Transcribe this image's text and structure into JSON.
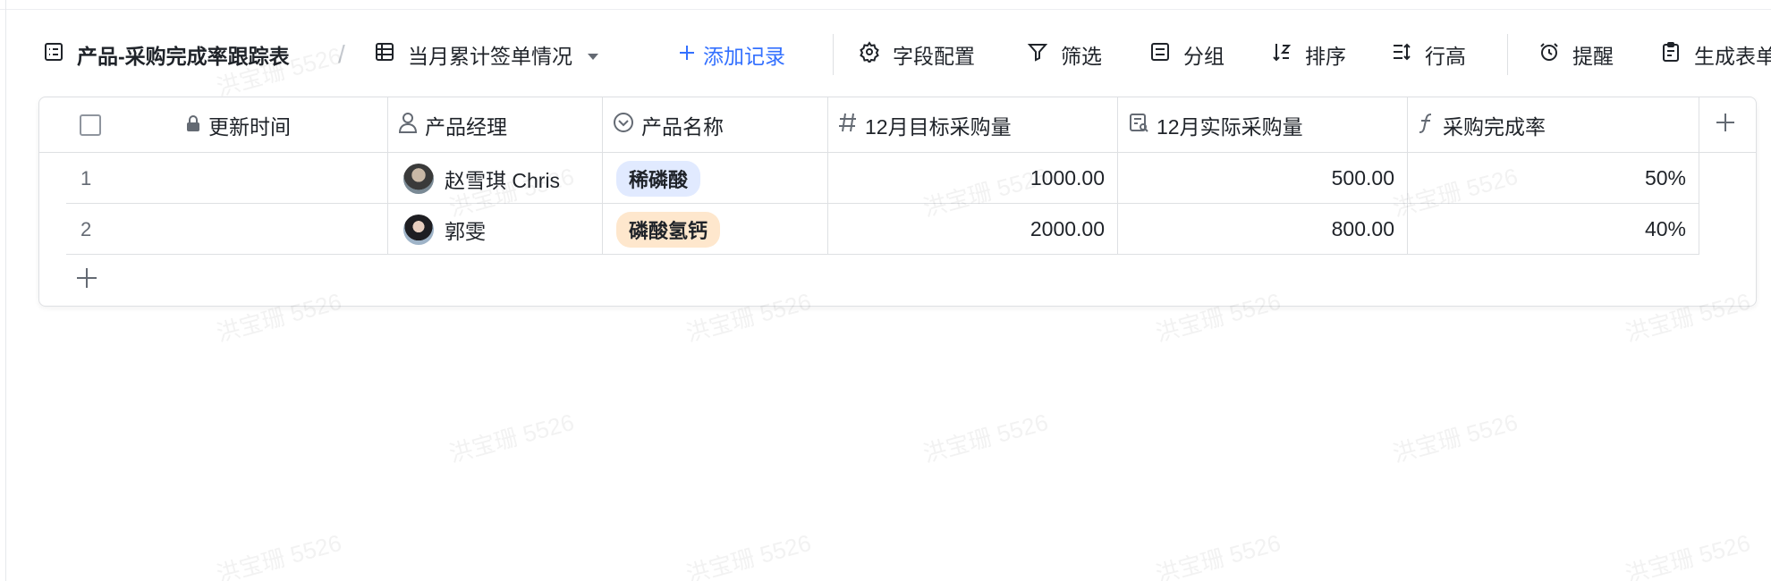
{
  "toolbar": {
    "table_name": "产品-采购完成率跟踪表",
    "view_name": "当月累计签单情况",
    "add_record": "添加记录",
    "field_config": "字段配置",
    "filter": "筛选",
    "group": "分组",
    "sort": "排序",
    "row_height": "行高",
    "reminder": "提醒",
    "generate_form": "生成表单"
  },
  "columns": [
    {
      "label": "更新时间",
      "icon": "lock-icon"
    },
    {
      "label": "产品经理",
      "icon": "person-icon"
    },
    {
      "label": "产品名称",
      "icon": "single-select-icon"
    },
    {
      "label": "12月目标采购量",
      "icon": "number-icon"
    },
    {
      "label": "12月实际采购量",
      "icon": "lookup-icon"
    },
    {
      "label": "采购完成率",
      "icon": "formula-icon"
    }
  ],
  "rows": [
    {
      "index": "1",
      "manager": "赵雪琪 Chris",
      "product": "稀磷酸",
      "product_color": "#e1eaff",
      "target": "1000.00",
      "actual": "500.00",
      "rate": "50%"
    },
    {
      "index": "2",
      "manager": "郭雯",
      "product": "磷酸氢钙",
      "product_color": "#fee7cd",
      "target": "2000.00",
      "actual": "800.00",
      "rate": "40%"
    }
  ],
  "watermark": "洪宝珊 5526",
  "colors": {
    "accent": "#3370ff",
    "border": "#dee0e3",
    "text": "#1f2329"
  }
}
